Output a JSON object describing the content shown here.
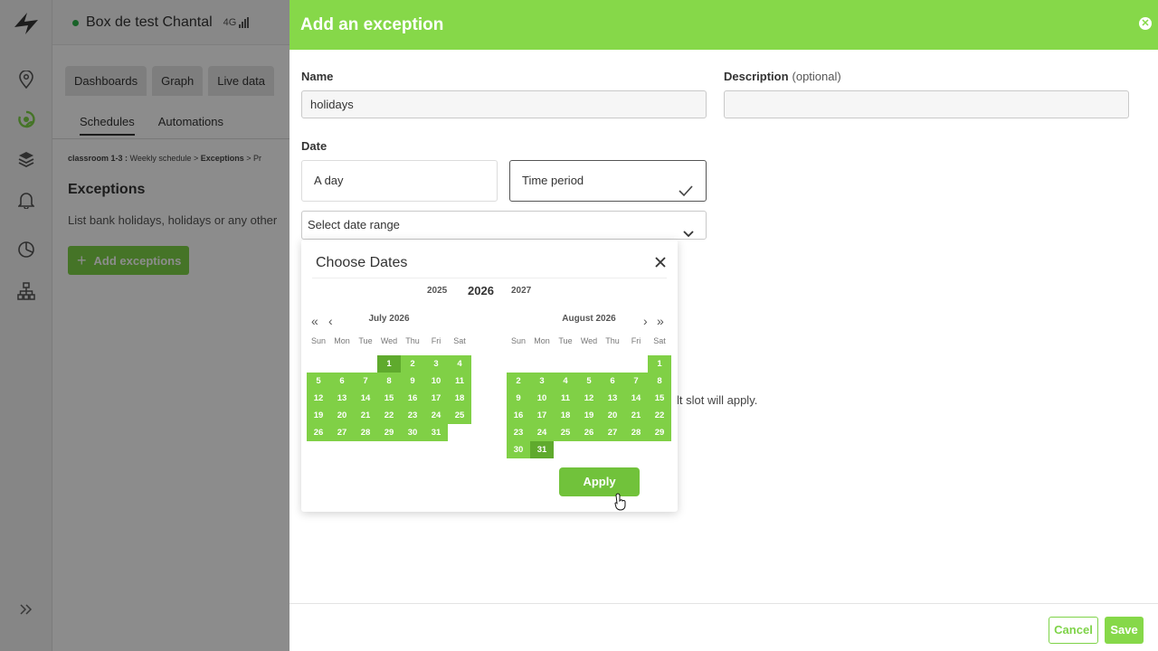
{
  "nav_rail": {
    "icons": [
      "logo-icon",
      "location-icon",
      "schedules-icon",
      "layers-icon",
      "bell-icon",
      "dashboard-icon",
      "hierarchy-icon",
      "expand-icon"
    ]
  },
  "background": {
    "device": {
      "name": "Box de test Chantal",
      "network": "4G"
    },
    "tabs": [
      "Dashboards",
      "Graph",
      "Live data"
    ],
    "subtabs": [
      "Schedules",
      "Automations"
    ],
    "breadcrumb": {
      "part1": "classroom 1-3 :",
      "part2": "Weekly schedule",
      "sep": ">",
      "part3": "Exceptions",
      "part4": "Pr"
    },
    "title": "Exceptions",
    "description": "List bank holidays, holidays or any other",
    "add_button": "Add exceptions",
    "plus": "+"
  },
  "panel": {
    "title": "Add an exception",
    "name_label": "Name",
    "name_value": "holidays",
    "description_label": "Description",
    "description_optional": "(optional)",
    "description_value": "",
    "date_label": "Date",
    "option_day": "A day",
    "option_period": "Time period",
    "select_placeholder": "Select date range",
    "hidden_text": "lt slot will apply.",
    "cancel": "Cancel",
    "save": "Save"
  },
  "picker": {
    "title": "Choose Dates",
    "years": {
      "prev": "2025",
      "current": "2026",
      "next": "2027"
    },
    "nav": {
      "prev_year": "«",
      "prev_month": "‹",
      "next_month": "›",
      "next_year": "»"
    },
    "weekdays": [
      "Sun",
      "Mon",
      "Tue",
      "Wed",
      "Thu",
      "Fri",
      "Sat"
    ],
    "months": [
      {
        "name": "July 2026",
        "first_weekday": 3,
        "days": 31
      },
      {
        "name": "August 2026",
        "first_weekday": 6,
        "days": 31
      }
    ],
    "range_start": "July 1 2026",
    "range_end": "August 31 2026",
    "apply": "Apply"
  },
  "colors": {
    "accent": "#86d849",
    "day_fill": "#80d046",
    "range_edge": "#5faa2d",
    "apply": "#71c23b"
  }
}
